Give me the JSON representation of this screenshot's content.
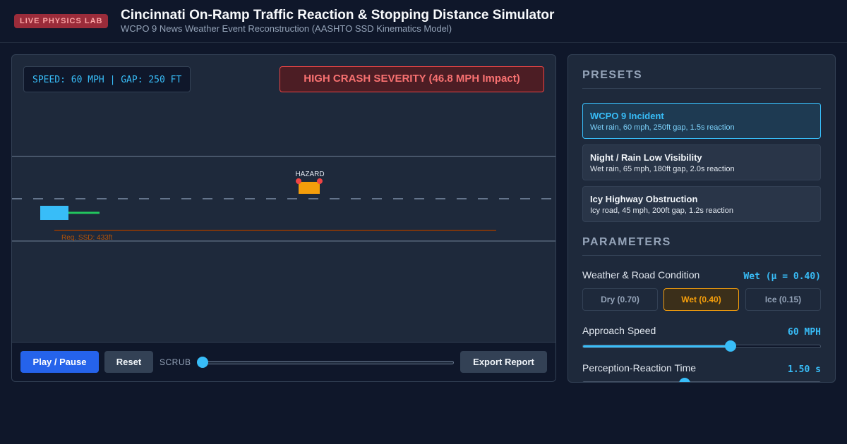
{
  "header": {
    "badge": "LIVE PHYSICS LAB",
    "title": "Cincinnati On-Ramp Traffic Reaction & Stopping Distance Simulator",
    "subtitle": "WCPO 9 News Weather Event Reconstruction (AASHTO SSD Kinematics Model)"
  },
  "simulation": {
    "readout": "SPEED: 60 MPH | GAP: 250 FT",
    "severity": "HIGH CRASH SEVERITY (46.8 MPH Impact)",
    "hazard_label": "HAZARD",
    "ssd_label": "Req. SSD: 433ft",
    "colors": {
      "vehicle": "#38bdf8",
      "hazard": "#f59e0b",
      "severity": "#ef4444",
      "ssd": "#b45309"
    }
  },
  "controls": {
    "play_pause": "Play / Pause",
    "reset": "Reset",
    "scrub_label": "SCRUB",
    "scrub_position": 0,
    "export": "Export Report"
  },
  "presets": {
    "title": "PRESETS",
    "items": [
      {
        "name": "WCPO 9 Incident",
        "desc": "Wet rain, 60 mph, 250ft gap, 1.5s reaction",
        "active": true
      },
      {
        "name": "Night / Rain Low Visibility",
        "desc": "Wet rain, 65 mph, 180ft gap, 2.0s reaction",
        "active": false
      },
      {
        "name": "Icy Highway Obstruction",
        "desc": "Icy road, 45 mph, 200ft gap, 1.2s reaction",
        "active": false
      }
    ]
  },
  "parameters": {
    "title": "PARAMETERS",
    "weather": {
      "label": "Weather & Road Condition",
      "value": "Wet (μ = 0.40)",
      "options": [
        "Dry (0.70)",
        "Wet (0.40)",
        "Ice (0.15)"
      ],
      "selected": "Wet (0.40)"
    },
    "speed": {
      "label": "Approach Speed",
      "value": "60 MPH",
      "fraction": 0.62
    },
    "reaction": {
      "label": "Perception-Reaction Time",
      "value": "1.50 s",
      "fraction": 0.43
    }
  }
}
